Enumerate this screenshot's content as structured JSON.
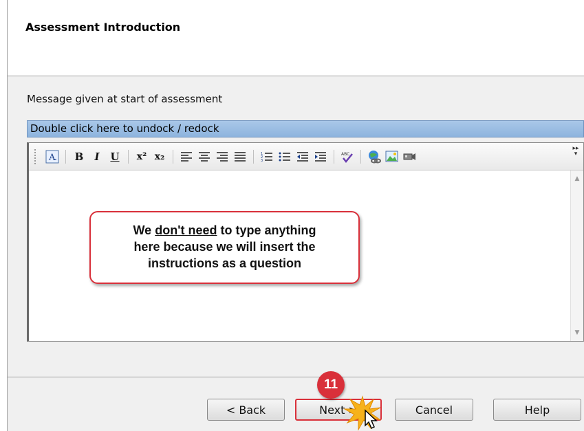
{
  "header": {
    "title": "Assessment Introduction"
  },
  "section": {
    "label": "Message given at start of assessment"
  },
  "dock_bar": {
    "label": "Double click here to undock / redock"
  },
  "toolbar": {
    "items": [
      "font-dialog",
      "bold",
      "italic",
      "underline",
      "superscript",
      "subscript",
      "align-left",
      "align-center",
      "align-right",
      "justify",
      "numbered-list",
      "bulleted-list",
      "outdent",
      "indent",
      "spell-check",
      "insert-link",
      "insert-image",
      "insert-media"
    ],
    "bold_label": "B",
    "italic_label": "I",
    "underline_label": "U",
    "superscript_label": "x²",
    "subscript_label": "x₂"
  },
  "callout": {
    "line1_prefix": "We ",
    "line1_underlined": "don't need",
    "line1_suffix": " to type anything",
    "line2": "here because we will insert the",
    "line3": "instructions as a question"
  },
  "step_badge": "11",
  "buttons": {
    "back_label": "< Back",
    "next_label": "Next >",
    "cancel_label": "Cancel",
    "help_label": "Help"
  },
  "colors": {
    "accent": "#d9303a",
    "dock_bar": "#9dbde3"
  }
}
